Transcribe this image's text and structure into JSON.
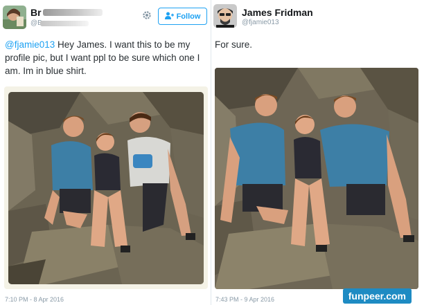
{
  "left_tweet": {
    "author_name": "Br",
    "author_handle": "@B",
    "follow_label": "Follow",
    "text_mention": "@fjamie013",
    "text_body": " Hey James. I want this to be my profile pic, but I want ppl to be sure which one I am. Im in blue shirt.",
    "timestamp": "7:10 PM - 8 Apr 2016",
    "icons": [
      "gear-icon",
      "add-user-icon"
    ]
  },
  "right_tweet": {
    "author_name": "James Fridman",
    "author_handle": "@fjamie013",
    "text": "For sure.",
    "timestamp": "7:43 PM - 9 Apr 2016"
  },
  "watermark": "funpeer.com",
  "colors": {
    "accent": "#1da1f2",
    "muted": "#8899a6",
    "photo_border": "#f4f2e6",
    "watermark_bg": "#1e8bc3"
  }
}
